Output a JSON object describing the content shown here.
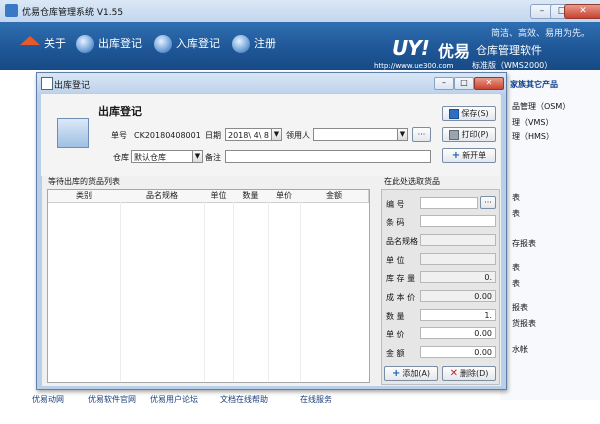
{
  "app": {
    "title": "优易仓库管理系统 V1.55",
    "window_buttons": [
      "–",
      "□",
      "✕"
    ],
    "slogan": "简洁、高效、易用为先。",
    "brand": {
      "logo": "UY!",
      "you": "优易",
      "name": "仓库管理软件",
      "url": "http://www.ue300.com",
      "edition": "标准版（WMS2000）"
    }
  },
  "nav": [
    {
      "label": "关于",
      "icon": "home-icon"
    },
    {
      "label": "出库登记",
      "icon": "globe-icon"
    },
    {
      "label": "入库登记",
      "icon": "globe-icon"
    },
    {
      "label": "注册",
      "icon": "globe-icon"
    }
  ],
  "right_panel": {
    "heading": "家族其它产品",
    "items": [
      "品管理（OSM）",
      "理（VMS）",
      "理（HMS）",
      "表",
      "表",
      "存报表",
      "表",
      "表",
      "报表",
      "货报表",
      "水帐"
    ]
  },
  "bottom_links": [
    "优易动网",
    "优易软件官网",
    "优易用户论坛",
    "文档在线帮助",
    "在线服务"
  ],
  "dialog": {
    "title": "出库登记",
    "form_title": "出库登记",
    "order_no_label": "单号",
    "order_no": "CK20180408001",
    "date_label": "日期",
    "date": "2018\\ 4\\ 8",
    "receiver_label": "领用人",
    "receiver": "",
    "warehouse_label": "仓库",
    "warehouse": "默认仓库",
    "remark_label": "备注",
    "remark": "",
    "browse": "···",
    "buttons": {
      "save": "保存(S)",
      "print": "打印(P)",
      "new": "新开单"
    },
    "pending_label": "等待出库的货品列表",
    "columns": [
      "类别",
      "品名规格",
      "单位",
      "数量",
      "单价",
      "金额"
    ],
    "selected_label": "在此处选取货品",
    "side": {
      "code": {
        "label": "编   号",
        "value": ""
      },
      "barcode": {
        "label": "条   码",
        "value": ""
      },
      "spec": {
        "label": "品名规格",
        "value": ""
      },
      "unit": {
        "label": "单   位",
        "value": ""
      },
      "stock": {
        "label": "库 存 量",
        "value": "0."
      },
      "cost": {
        "label": "成 本 价",
        "value": "0.00"
      },
      "qty": {
        "label": "数   量",
        "value": "1."
      },
      "price": {
        "label": "单   价",
        "value": "0.00"
      },
      "amount": {
        "label": "金   额",
        "value": "0.00"
      }
    },
    "add_button": "添加(A)",
    "delete_button": "删除(D)"
  },
  "colors": {
    "banner": "#1f5797",
    "dialog_border": "#b8cfe9"
  }
}
